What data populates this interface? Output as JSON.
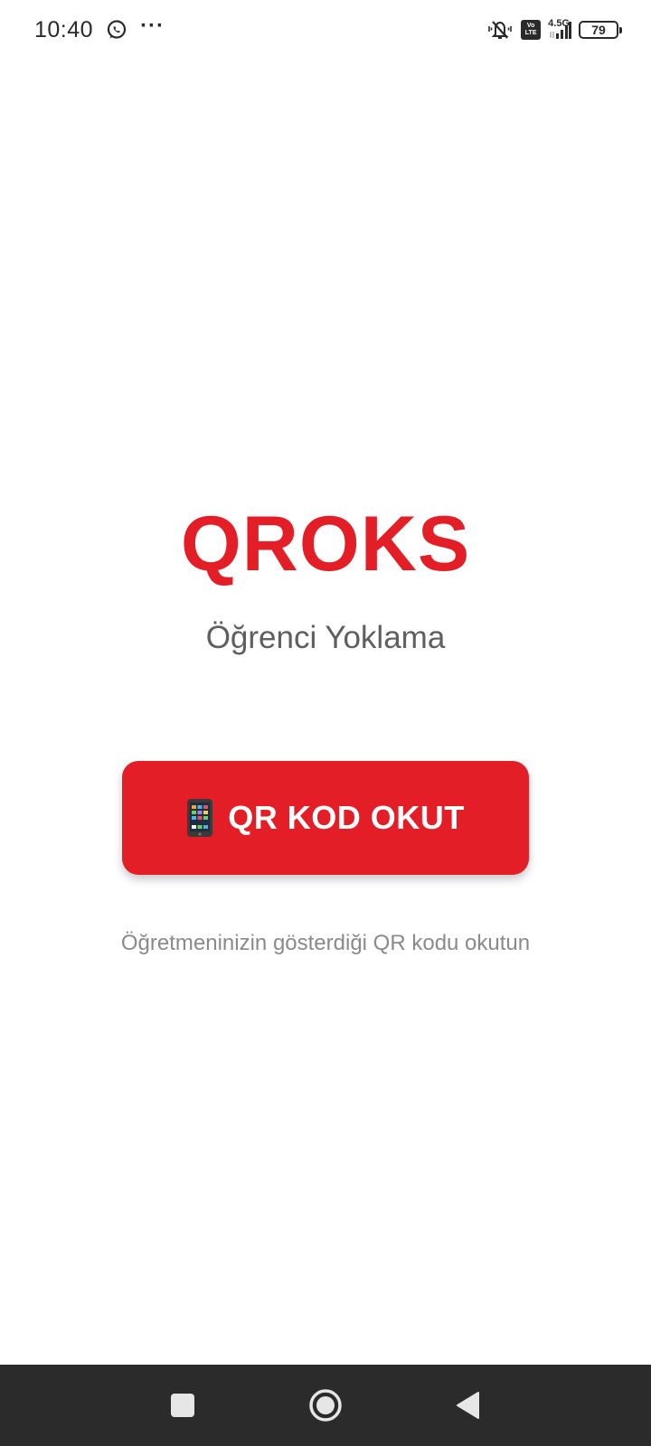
{
  "status_bar": {
    "time": "10:40",
    "network_type": "4.5G",
    "volte_top": "Vo",
    "volte_bottom": "LTE",
    "battery_level": "79",
    "icons": [
      "whatsapp-icon",
      "more-icon",
      "mute-icon",
      "volte-icon",
      "signal-icon",
      "battery-icon"
    ]
  },
  "app": {
    "title": "QROKS",
    "subtitle": "Öğrenci Yoklama",
    "scan_button_label": "QR KOD OKUT",
    "scan_button_icon": "mobile-phone-icon",
    "hint": "Öğretmeninizin gösterdiği QR kodu okutun"
  },
  "nav_bar": {
    "buttons": [
      "recent-apps-button",
      "home-button",
      "back-button"
    ]
  },
  "colors": {
    "brand_red": "#e31e27",
    "subtitle_gray": "#5f5f5f",
    "hint_gray": "#8a8a8a",
    "nav_bar_bg": "#2b2b2b"
  }
}
